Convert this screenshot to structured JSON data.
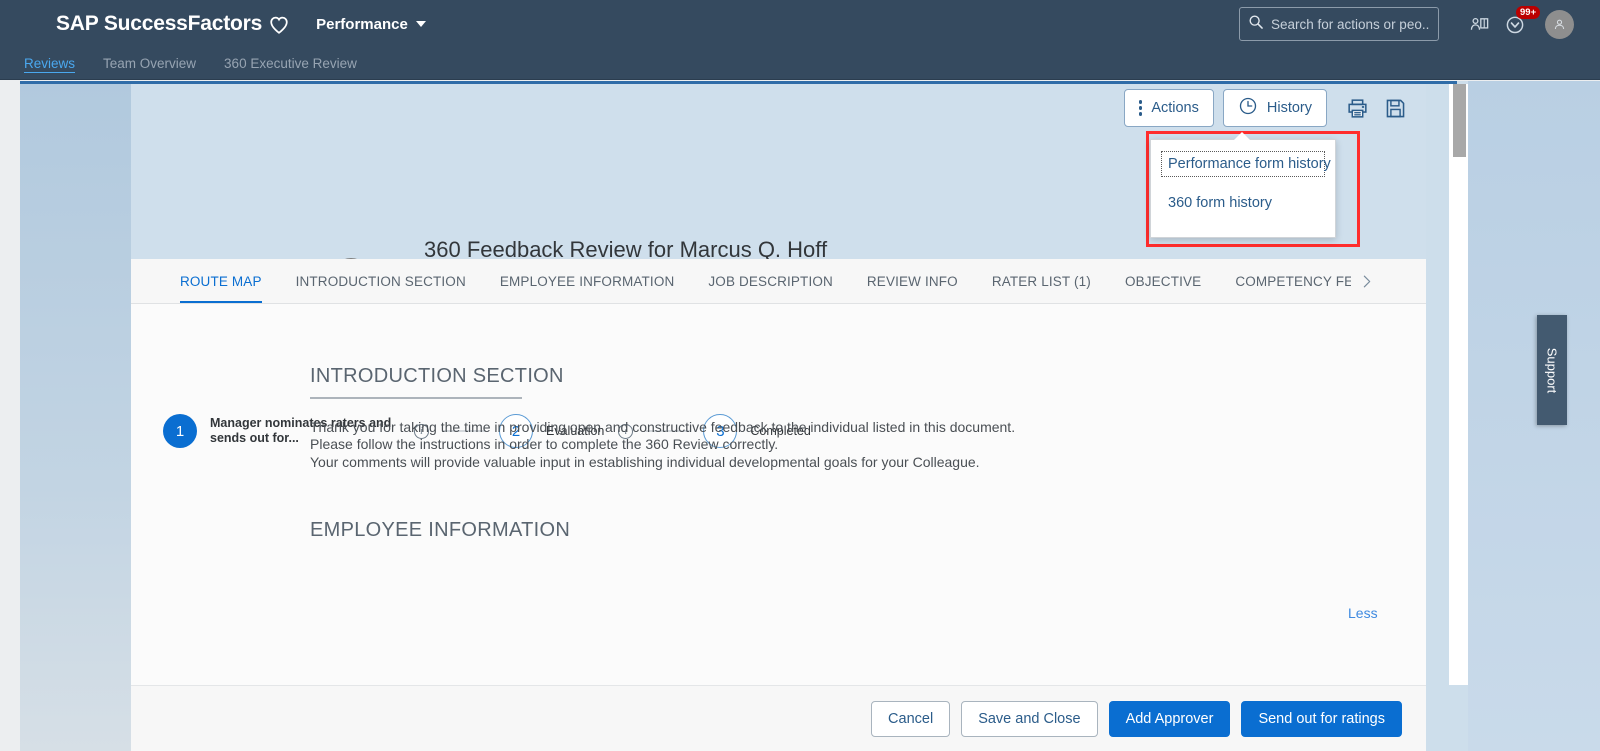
{
  "shell": {
    "logo": "SAP SuccessFactors",
    "logo_icon": "heart-icon",
    "module": "Performance",
    "search_placeholder": "Search for actions or peo...",
    "search_value": "",
    "search_icon": "search-icon",
    "directory_icon": "people-directory-icon",
    "notifications_icon": "notification-chevron-icon",
    "notifications_badge": "99+",
    "avatar_icon": "user-avatar-icon"
  },
  "subnav": {
    "items": [
      {
        "label": "Reviews",
        "active": true
      },
      {
        "label": "Team Overview",
        "active": false
      },
      {
        "label": "360 Executive Review",
        "active": false
      }
    ]
  },
  "toolbar": {
    "actions_label": "Actions",
    "actions_icon": "vertical-dots-icon",
    "history_label": "History",
    "history_icon": "clock-icon",
    "print_icon": "printer-icon",
    "save_icon": "floppy-save-icon"
  },
  "history_menu": {
    "items": [
      {
        "label": "Performance form history",
        "focused": true
      },
      {
        "label": "360 form history",
        "focused": false
      }
    ],
    "highlight_color": "#ff2d2d"
  },
  "document": {
    "title": "360 Feedback Review for Marcus Q. Hoff",
    "subject": "Marcus Q. Hoff",
    "subject_icon": "contact-card-icon",
    "avatar_icon": "user-avatar-icon"
  },
  "tabs": {
    "items": [
      {
        "label": "ROUTE MAP",
        "active": true
      },
      {
        "label": "INTRODUCTION SECTION",
        "active": false
      },
      {
        "label": "EMPLOYEE INFORMATION",
        "active": false
      },
      {
        "label": "JOB DESCRIPTION",
        "active": false
      },
      {
        "label": "REVIEW INFO",
        "active": false
      },
      {
        "label": "RATER LIST (1)",
        "active": false
      },
      {
        "label": "OBJECTIVE",
        "active": false
      },
      {
        "label": "COMPETENCY FEEDB",
        "active": false
      }
    ],
    "next_icon": "chevron-right-icon",
    "overflow_icon": "chevron-down-icon"
  },
  "routemap": {
    "steps": [
      {
        "number": "1",
        "label": "Manager nominates raters and sends out for...",
        "state": "active",
        "info_icon": "info-icon"
      },
      {
        "number": "2",
        "label": "Evaluation",
        "state": "pending",
        "info_icon": "info-icon"
      },
      {
        "number": "3",
        "label": "Completed",
        "state": "pending",
        "info_icon": ""
      }
    ]
  },
  "sections": {
    "introduction": {
      "heading": "INTRODUCTION SECTION",
      "line1": "Thank you for taking the time in providing open and constructive feedback to the individual listed in this document.",
      "line2": "Please follow the instructions in order to complete the 360 Review correctly.",
      "line3": "Your comments will provide valuable input in establishing individual developmental goals for your Colleague.",
      "toggle_label": "Less"
    },
    "employee": {
      "heading": "EMPLOYEE INFORMATION"
    }
  },
  "footer": {
    "buttons": [
      {
        "label": "Cancel",
        "style": "outline"
      },
      {
        "label": "Save and Close",
        "style": "outline"
      },
      {
        "label": "Add Approver",
        "style": "primary"
      },
      {
        "label": "Send out for ratings",
        "style": "primary"
      }
    ]
  },
  "support": {
    "label": "Support"
  },
  "colors": {
    "shell_bg": "#354a5f",
    "accent_blue": "#0a6ed1",
    "link_blue": "#3f8ae0",
    "badge_red": "#bb0000",
    "highlight_red": "#ff2d2d"
  }
}
